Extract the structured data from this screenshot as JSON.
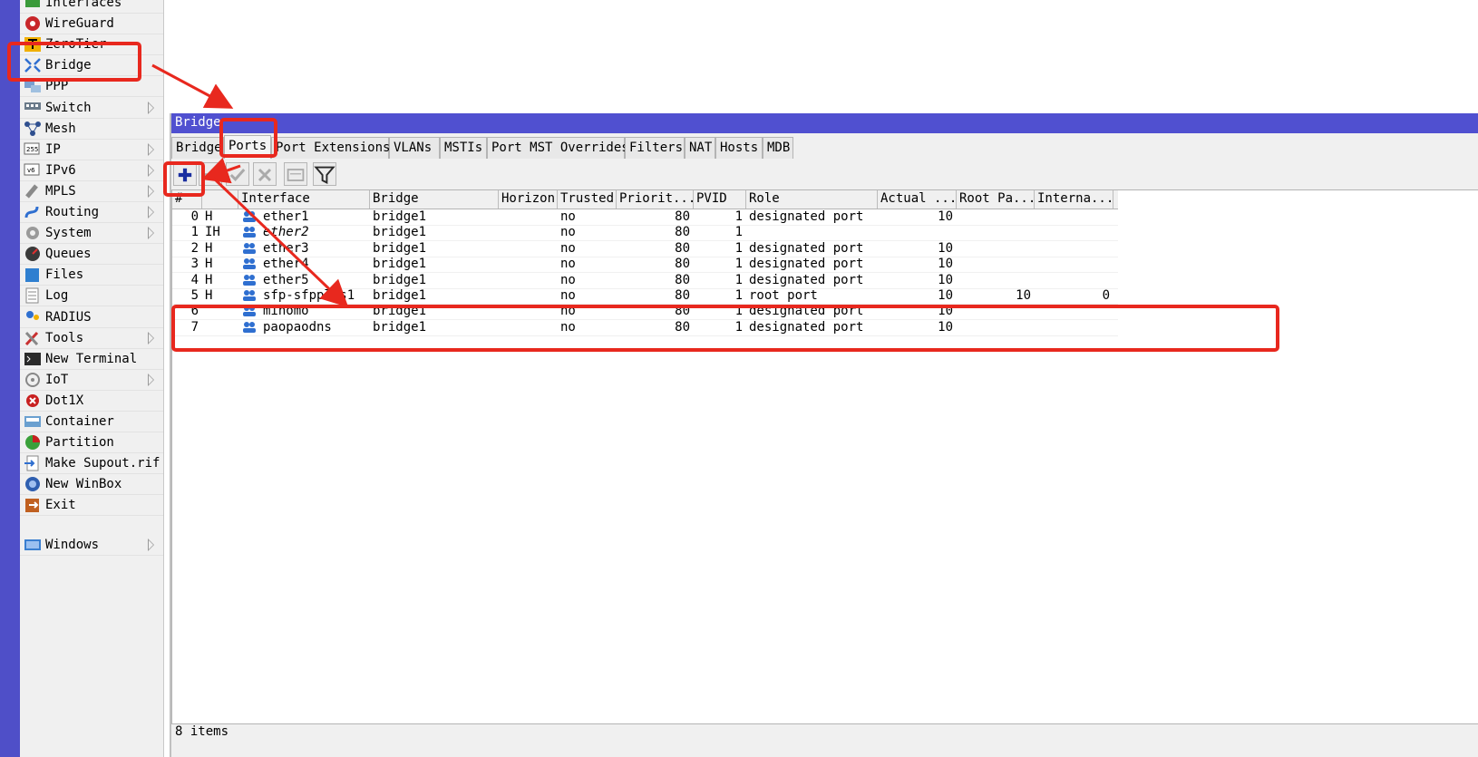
{
  "sidebar": {
    "items": [
      {
        "label": "Interfaces",
        "icon": "interfaces-icon",
        "submenu": false
      },
      {
        "label": "WireGuard",
        "icon": "wireguard-icon",
        "submenu": false
      },
      {
        "label": "ZeroTier",
        "icon": "zerotier-icon",
        "submenu": false
      },
      {
        "label": "Bridge",
        "icon": "bridge-icon",
        "submenu": false
      },
      {
        "label": "PPP",
        "icon": "ppp-icon",
        "submenu": false
      },
      {
        "label": "Switch",
        "icon": "switch-icon",
        "submenu": true
      },
      {
        "label": "Mesh",
        "icon": "mesh-icon",
        "submenu": false
      },
      {
        "label": "IP",
        "icon": "ip-icon",
        "submenu": true
      },
      {
        "label": "IPv6",
        "icon": "ipv6-icon",
        "submenu": true
      },
      {
        "label": "MPLS",
        "icon": "mpls-icon",
        "submenu": true
      },
      {
        "label": "Routing",
        "icon": "routing-icon",
        "submenu": true
      },
      {
        "label": "System",
        "icon": "system-icon",
        "submenu": true
      },
      {
        "label": "Queues",
        "icon": "queues-icon",
        "submenu": false
      },
      {
        "label": "Files",
        "icon": "files-icon",
        "submenu": false
      },
      {
        "label": "Log",
        "icon": "log-icon",
        "submenu": false
      },
      {
        "label": "RADIUS",
        "icon": "radius-icon",
        "submenu": false
      },
      {
        "label": "Tools",
        "icon": "tools-icon",
        "submenu": true
      },
      {
        "label": "New Terminal",
        "icon": "terminal-icon",
        "submenu": false
      },
      {
        "label": "IoT",
        "icon": "iot-icon",
        "submenu": true
      },
      {
        "label": "Dot1X",
        "icon": "dot1x-icon",
        "submenu": false
      },
      {
        "label": "Container",
        "icon": "container-icon",
        "submenu": false
      },
      {
        "label": "Partition",
        "icon": "partition-icon",
        "submenu": false
      },
      {
        "label": "Make Supout.rif",
        "icon": "supout-icon",
        "submenu": false
      },
      {
        "label": "New WinBox",
        "icon": "winbox-icon",
        "submenu": false
      },
      {
        "label": "Exit",
        "icon": "exit-icon",
        "submenu": false
      }
    ],
    "windows": {
      "label": "Windows",
      "icon": "windows-icon",
      "submenu": true
    }
  },
  "window": {
    "title": "Bridge",
    "tabs": [
      "Bridge",
      "Ports",
      "Port Extensions",
      "VLANs",
      "MSTIs",
      "Port MST Overrides",
      "Filters",
      "NAT",
      "Hosts",
      "MDB"
    ],
    "active_tab": "Ports",
    "toolbar": [
      "add-icon",
      "remove-icon",
      "enable-icon",
      "disable-icon",
      "comment-icon",
      "filter-icon"
    ]
  },
  "table": {
    "columns": [
      "#",
      "",
      "Interface",
      "Bridge",
      "Horizon",
      "Trusted",
      "Priorit...",
      "PVID",
      "Role",
      "Actual ...",
      "Root Pa...",
      "Interna..."
    ],
    "rows": [
      {
        "num": "0",
        "flags": "H",
        "iface": "ether1",
        "bridge": "bridge1",
        "horizon": "",
        "trusted": "no",
        "priority": "80",
        "pvid": "1",
        "role": "designated port",
        "actual": "10",
        "rootpath": "",
        "internal": "",
        "italic": false
      },
      {
        "num": "1",
        "flags": "IH",
        "iface": "ether2",
        "bridge": "bridge1",
        "horizon": "",
        "trusted": "no",
        "priority": "80",
        "pvid": "1",
        "role": "",
        "actual": "",
        "rootpath": "",
        "internal": "",
        "italic": true
      },
      {
        "num": "2",
        "flags": "H",
        "iface": "ether3",
        "bridge": "bridge1",
        "horizon": "",
        "trusted": "no",
        "priority": "80",
        "pvid": "1",
        "role": "designated port",
        "actual": "10",
        "rootpath": "",
        "internal": "",
        "italic": false
      },
      {
        "num": "3",
        "flags": "H",
        "iface": "ether4",
        "bridge": "bridge1",
        "horizon": "",
        "trusted": "no",
        "priority": "80",
        "pvid": "1",
        "role": "designated port",
        "actual": "10",
        "rootpath": "",
        "internal": "",
        "italic": false
      },
      {
        "num": "4",
        "flags": "H",
        "iface": "ether5",
        "bridge": "bridge1",
        "horizon": "",
        "trusted": "no",
        "priority": "80",
        "pvid": "1",
        "role": "designated port",
        "actual": "10",
        "rootpath": "",
        "internal": "",
        "italic": false
      },
      {
        "num": "5",
        "flags": "H",
        "iface": "sfp-sfpplus1",
        "bridge": "bridge1",
        "horizon": "",
        "trusted": "no",
        "priority": "80",
        "pvid": "1",
        "role": "root port",
        "actual": "10",
        "rootpath": "10",
        "internal": "0",
        "italic": false
      },
      {
        "num": "6",
        "flags": "",
        "iface": "mihomo",
        "bridge": "bridge1",
        "horizon": "",
        "trusted": "no",
        "priority": "80",
        "pvid": "1",
        "role": "designated port",
        "actual": "10",
        "rootpath": "",
        "internal": "",
        "italic": false
      },
      {
        "num": "7",
        "flags": "",
        "iface": "paopaodns",
        "bridge": "bridge1",
        "horizon": "",
        "trusted": "no",
        "priority": "80",
        "pvid": "1",
        "role": "designated port",
        "actual": "10",
        "rootpath": "",
        "internal": "",
        "italic": false
      }
    ]
  },
  "status": {
    "text": "8 items"
  },
  "colors": {
    "title_bar": "#5050d0",
    "left_strip": "#4f4fc8",
    "highlight": "#e8281e",
    "iface_icon": "#2f6fd0"
  }
}
